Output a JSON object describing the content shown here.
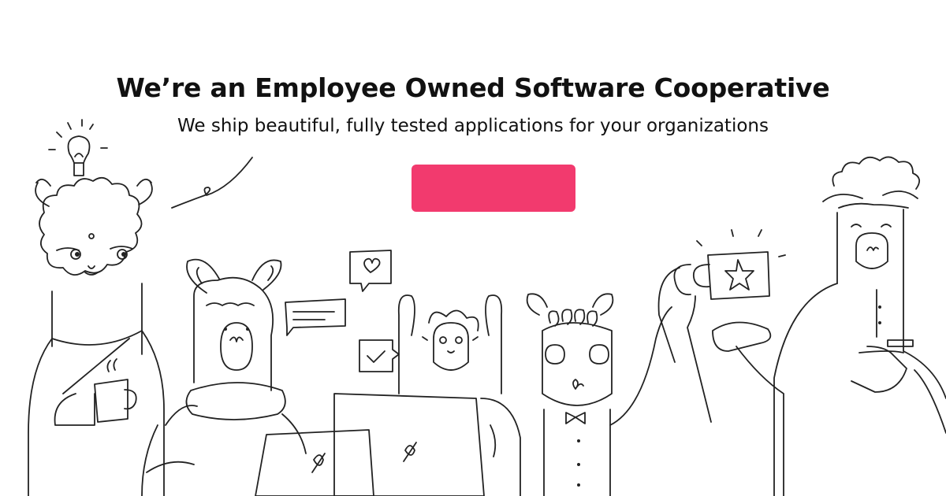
{
  "hero": {
    "title": "We’re an Employee Owned Software Cooperative",
    "subtitle": "We ship beautiful, fully tested applications for your organizations",
    "cta_color": "#f23a6e"
  },
  "illustration": {
    "characters": [
      "llama-with-mug",
      "llama-with-laptop",
      "llama-with-laptop-center",
      "llama-with-bowtie",
      "llama-with-mug-star",
      "llama-pointing"
    ],
    "icons": [
      "lightbulb-icon",
      "heart-bubble-icon",
      "speech-bubble-icon",
      "checkmark-bubble-icon",
      "star-mug-icon",
      "laptop-logo-icon"
    ]
  }
}
